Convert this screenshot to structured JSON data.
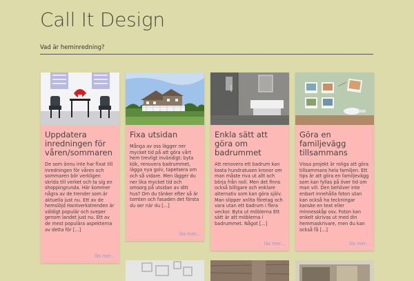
{
  "site": {
    "title": "Call It Design",
    "tagline": "Vad är heminredning?"
  },
  "posts": [
    {
      "title": "Uppdatera inredningen för våren/sommaren",
      "excerpt": "De som ännu inte har fixat till inredningen för våren och sommaren bör verkligen skrida till verket och ta sig en shoppingrunda. Här kommer några av de trender som är aktuella just nu. Ett av de hemslöjd Hantverkstrenden är väldigt populär och sveper genom landet just nu. Ett av de mest populära aspekterna av detta för [...]",
      "more": "läs mer..."
    },
    {
      "title": "Fixa utsidan",
      "excerpt": "Många av oss lägger ner mycket tid på att göra vårt hem trevligt invändigt: byta kök, renovera badrummet, lägga nya golv, tapetsera om och så vidare. Men lägger du ner lika mycket tid och omsorg på utsidan av ditt hus? Om du tänker efter så är tomten och fasaden det första du ser när du [...]",
      "more": "läs mer..."
    },
    {
      "title": "Enkla sätt att göra om badrummet",
      "excerpt": "Att renovera ett badrum kan kosta hundratusen kronor om man måste riva ut allt och börja från noll. Men det finns också billigare och enklare alternativ som kan göra själv. Man slipper anlita företag och vara utan ett badrum i flera veckor. Byta ut möblerna Ett sätt är att möblerna i badrummet. Något [...]",
      "more": "läs mer..."
    },
    {
      "title": "Göra en familjevägg tillsammans",
      "excerpt": "Vissa projekt är roliga att göra tillsammans hela familjen. Ett tips är att göra en familjevägg som kan fyllas på över tid om man vill. Den behöver inte enbart innehålla foton utan kan också ha teckningar kanske en text eller minnesskåp osv. Foton kan enkelt skrivas ut med din hemmaskrivare, men du kan också få [...]",
      "more": "läs mer..."
    }
  ]
}
